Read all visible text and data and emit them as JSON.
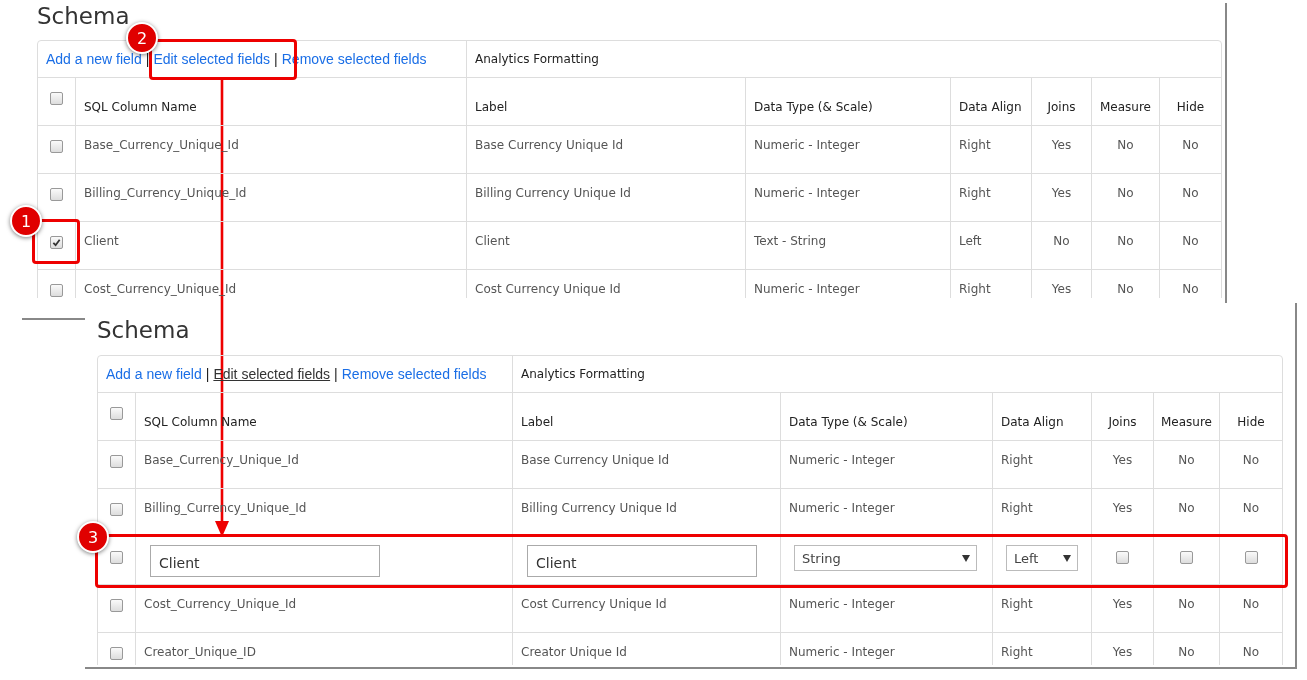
{
  "panels": [
    {
      "title": "Schema",
      "toolbar": [
        {
          "kind": "link",
          "text": "Add a new field",
          "underlined": false
        },
        {
          "kind": "separator",
          "text": "|",
          "underlined": false
        },
        {
          "kind": "link",
          "text": "Edit selected fields",
          "underlined": false
        },
        {
          "kind": "separator",
          "text": "|",
          "underlined": false
        },
        {
          "kind": "link",
          "text": "Remove selected fields",
          "underlined": false
        }
      ],
      "section": "Analytics Formatting",
      "header_checked": false,
      "columns": [
        "SQL Column Name",
        "Label",
        "Data Type (& Scale)",
        "Data Align",
        "Joins",
        "Measure",
        "Hide"
      ],
      "rows": [
        {
          "checked": false,
          "cells": [
            {
              "kind": "text",
              "text": "Base_Currency_Unique_Id"
            },
            {
              "kind": "text",
              "text": "Base Currency Unique Id"
            },
            {
              "kind": "text",
              "text": "Numeric - Integer"
            },
            {
              "kind": "text",
              "text": "Right"
            },
            {
              "kind": "text",
              "text": "Yes"
            },
            {
              "kind": "text",
              "text": "No"
            },
            {
              "kind": "text",
              "text": "No"
            }
          ]
        },
        {
          "checked": false,
          "cells": [
            {
              "kind": "text",
              "text": "Billing_Currency_Unique_Id"
            },
            {
              "kind": "text",
              "text": "Billing Currency Unique Id"
            },
            {
              "kind": "text",
              "text": "Numeric - Integer"
            },
            {
              "kind": "text",
              "text": "Right"
            },
            {
              "kind": "text",
              "text": "Yes"
            },
            {
              "kind": "text",
              "text": "No"
            },
            {
              "kind": "text",
              "text": "No"
            }
          ]
        },
        {
          "checked": true,
          "cells": [
            {
              "kind": "text",
              "text": "Client"
            },
            {
              "kind": "text",
              "text": "Client"
            },
            {
              "kind": "text",
              "text": "Text - String"
            },
            {
              "kind": "text",
              "text": "Left"
            },
            {
              "kind": "text",
              "text": "No"
            },
            {
              "kind": "text",
              "text": "No"
            },
            {
              "kind": "text",
              "text": "No"
            }
          ]
        },
        {
          "checked": false,
          "cells": [
            {
              "kind": "text",
              "text": "Cost_Currency_Unique_Id"
            },
            {
              "kind": "text",
              "text": "Cost Currency Unique Id"
            },
            {
              "kind": "text",
              "text": "Numeric - Integer"
            },
            {
              "kind": "text",
              "text": "Right"
            },
            {
              "kind": "text",
              "text": "Yes"
            },
            {
              "kind": "text",
              "text": "No"
            },
            {
              "kind": "text",
              "text": "No"
            }
          ]
        }
      ]
    },
    {
      "title": "Schema",
      "toolbar": [
        {
          "kind": "link",
          "text": "Add a new field",
          "underlined": false
        },
        {
          "kind": "separator",
          "text": "|",
          "underlined": false
        },
        {
          "kind": "link",
          "text": "Edit selected fields",
          "underlined": true
        },
        {
          "kind": "separator",
          "text": "|",
          "underlined": false
        },
        {
          "kind": "link",
          "text": "Remove selected fields",
          "underlined": false
        }
      ],
      "section": "Analytics Formatting",
      "header_checked": false,
      "columns": [
        "SQL Column Name",
        "Label",
        "Data Type (& Scale)",
        "Data Align",
        "Joins",
        "Measure",
        "Hide"
      ],
      "rows": [
        {
          "checked": false,
          "cells": [
            {
              "kind": "text",
              "text": "Base_Currency_Unique_Id"
            },
            {
              "kind": "text",
              "text": "Base Currency Unique Id"
            },
            {
              "kind": "text",
              "text": "Numeric - Integer"
            },
            {
              "kind": "text",
              "text": "Right"
            },
            {
              "kind": "text",
              "text": "Yes"
            },
            {
              "kind": "text",
              "text": "No"
            },
            {
              "kind": "text",
              "text": "No"
            }
          ]
        },
        {
          "checked": false,
          "cells": [
            {
              "kind": "text",
              "text": "Billing_Currency_Unique_Id"
            },
            {
              "kind": "text",
              "text": "Billing Currency Unique Id"
            },
            {
              "kind": "text",
              "text": "Numeric - Integer"
            },
            {
              "kind": "text",
              "text": "Right"
            },
            {
              "kind": "text",
              "text": "Yes"
            },
            {
              "kind": "text",
              "text": "No"
            },
            {
              "kind": "text",
              "text": "No"
            }
          ]
        },
        {
          "checked": false,
          "cells": [
            {
              "kind": "input",
              "value": "Client"
            },
            {
              "kind": "input",
              "value": "Client"
            },
            {
              "kind": "select",
              "value": "String"
            },
            {
              "kind": "select",
              "value": "Left"
            },
            {
              "kind": "checkbox",
              "checked": false
            },
            {
              "kind": "checkbox",
              "checked": false
            },
            {
              "kind": "checkbox",
              "checked": false
            }
          ]
        },
        {
          "checked": false,
          "cells": [
            {
              "kind": "text",
              "text": "Cost_Currency_Unique_Id"
            },
            {
              "kind": "text",
              "text": "Cost Currency Unique Id"
            },
            {
              "kind": "text",
              "text": "Numeric - Integer"
            },
            {
              "kind": "text",
              "text": "Right"
            },
            {
              "kind": "text",
              "text": "Yes"
            },
            {
              "kind": "text",
              "text": "No"
            },
            {
              "kind": "text",
              "text": "No"
            }
          ]
        },
        {
          "checked": false,
          "cells": [
            {
              "kind": "text",
              "text": "Creator_Unique_ID"
            },
            {
              "kind": "text",
              "text": "Creator Unique Id"
            },
            {
              "kind": "text",
              "text": "Numeric - Integer"
            },
            {
              "kind": "text",
              "text": "Right"
            },
            {
              "kind": "text",
              "text": "Yes"
            },
            {
              "kind": "text",
              "text": "No"
            },
            {
              "kind": "text",
              "text": "No"
            }
          ]
        }
      ]
    }
  ],
  "annotations": [
    {
      "number": "1"
    },
    {
      "number": "2"
    },
    {
      "number": "3"
    }
  ]
}
